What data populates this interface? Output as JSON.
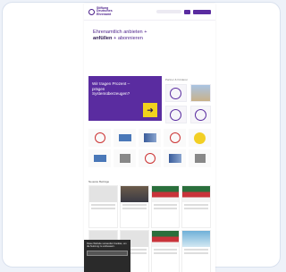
{
  "header": {
    "logo_text": "Stiftung Deutsches Ehrenamt"
  },
  "hero": {
    "line1": "Ehrenamtlich anbieten +",
    "line2_bold": "anfüllen",
    "line2_rest": " + abonnieren"
  },
  "promo": {
    "text": "Wir tragen Prozent – prägen Systemüberzeugen?",
    "arrow": "➜"
  },
  "side": {
    "title": "Partner & Förderer"
  },
  "section": {
    "title": "Neueste Beiträge"
  },
  "cookie": {
    "text": "Diese Website verwendet Cookies, um die Nutzung zu verbessern.",
    "button": "Akzeptieren"
  },
  "colors": {
    "brand_purple": "#5a2ca0",
    "accent_yellow": "#f2d21c"
  }
}
